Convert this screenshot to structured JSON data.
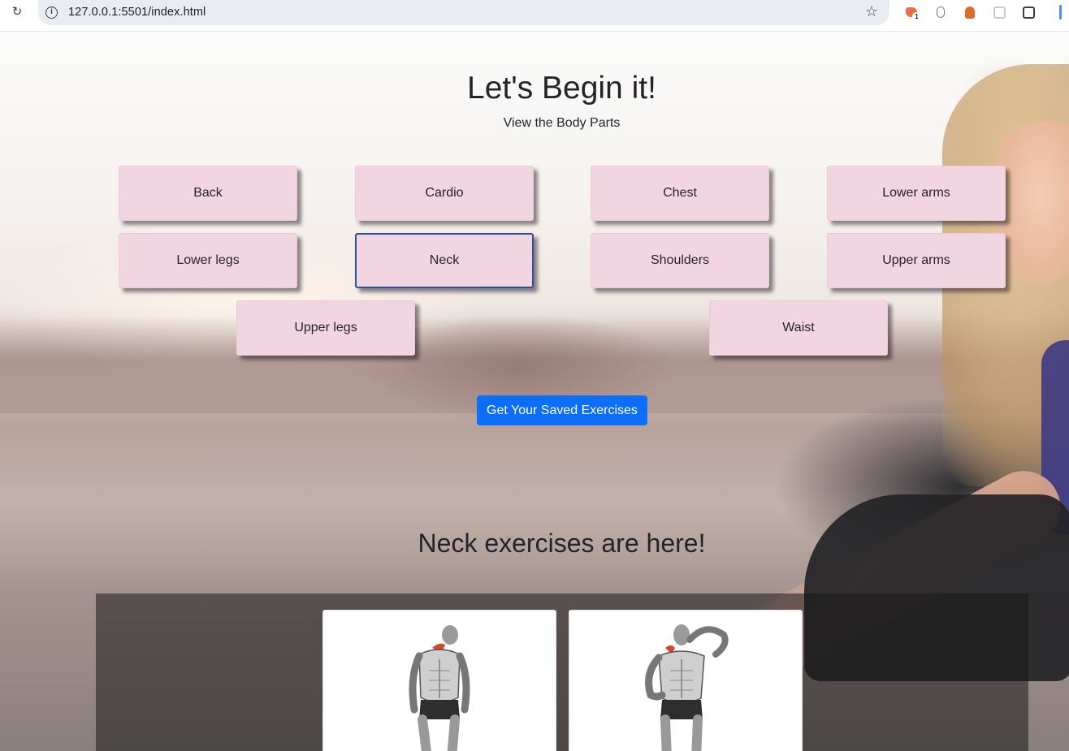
{
  "browser": {
    "url": "127.0.0.1:5501/index.html",
    "extension_badge": "1"
  },
  "hero": {
    "title": "Let's Begin it!",
    "subtitle": "View the Body Parts"
  },
  "body_parts": [
    {
      "label": "Back",
      "selected": false
    },
    {
      "label": "Cardio",
      "selected": false
    },
    {
      "label": "Chest",
      "selected": false
    },
    {
      "label": "Lower arms",
      "selected": false
    },
    {
      "label": "Lower legs",
      "selected": false
    },
    {
      "label": "Neck",
      "selected": true
    },
    {
      "label": "Shoulders",
      "selected": false
    },
    {
      "label": "Upper arms",
      "selected": false
    },
    {
      "label": "Upper legs",
      "selected": false
    },
    {
      "label": "Waist",
      "selected": false
    }
  ],
  "saved_button": {
    "label": "Get Your Saved Exercises"
  },
  "results": {
    "title": "Neck exercises are here!"
  },
  "colors": {
    "part_button_bg": "#f1d5e1",
    "primary": "#0d6efd",
    "selected_border": "#2c4f9e",
    "text": "#212529"
  }
}
